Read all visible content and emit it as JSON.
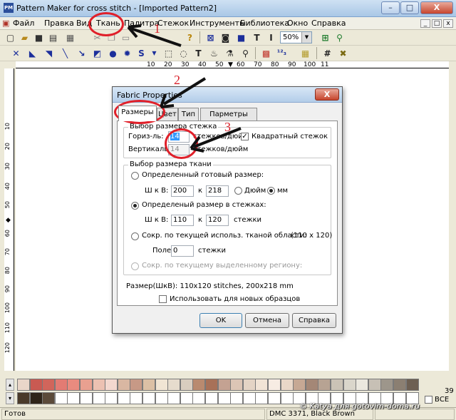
{
  "window": {
    "title": "Pattern Maker for cross stitch - [Imported Pattern2]",
    "app_icon_text": "PM",
    "minimize": "–",
    "maximize": "□",
    "close": "X"
  },
  "menubar": {
    "items": [
      "Файл",
      "Правка",
      "Вид",
      "Ткань",
      "Палитра",
      "Стежок",
      "Инструменты",
      "Библиотека",
      "Окно",
      "Справка"
    ],
    "mdi_buttons": [
      "_",
      "□",
      "x"
    ]
  },
  "toolbar1": {
    "zoom_value": "50%"
  },
  "ruler": {
    "top_labels": [
      "10",
      "20",
      "30",
      "40",
      "50",
      "60",
      "70",
      "80",
      "90",
      "100",
      "11"
    ],
    "left_labels": [
      "10",
      "20",
      "30",
      "40",
      "50",
      "60",
      "70",
      "80",
      "90",
      "100",
      "110",
      "120"
    ]
  },
  "dialog": {
    "title": "Fabric Properties",
    "close": "X",
    "tabs": [
      "Размеры",
      "Цвет",
      "Тип",
      "Парметры сетки"
    ],
    "stitch_group": {
      "label": "Выбор размера стежка",
      "horizontal_label": "Гориз-ль:",
      "horizontal_value": "14",
      "horizontal_unit": "стежков/дюйм",
      "vertical_label": "Вертикальн:",
      "vertical_value": "14",
      "vertical_unit": "стежков/дюйм",
      "square_label": "Квадратный стежок",
      "square_checked": "✓"
    },
    "fabric_group": {
      "label": "Выбор размера ткани",
      "opt1_label": "Определенный готовый размер:",
      "opt1_wxh_label": "Ш к В:",
      "opt1_w": "200",
      "opt1_k": "к",
      "opt1_h": "218",
      "opt1_inch": "Дюйм",
      "opt1_mm": "мм",
      "opt2_label": "Определеный размер в стежках:",
      "opt2_wxh_label": "Ш к В:",
      "opt2_w": "110",
      "opt2_k": "к",
      "opt2_h": "120",
      "opt2_unit": "стежки",
      "opt3_label": "Сокр. по текущей использ. тканой области:",
      "opt3_size": "(110 x 120)",
      "opt3_field_label": "Поле:",
      "opt3_field_value": "0",
      "opt3_unit": "стежки",
      "opt4_label": "Сокр. по текущему выделенному региону:"
    },
    "size_summary": "Размер(ШкВ):  110x120 stitches,  200x218 mm",
    "use_for_new_label": "Использовать для новых образцов",
    "buttons": {
      "ok": "OK",
      "cancel": "Отмена",
      "help": "Справка"
    }
  },
  "palette": {
    "row1_colors": [
      "#e9d6c9",
      "#c95a52",
      "#d1655b",
      "#e37b73",
      "#e98b7f",
      "#e9a090",
      "#ecc1b2",
      "#f3d8cf",
      "#d9b7a2",
      "#c79986",
      "#dcc0a5",
      "#f1e5d4",
      "#e6dccd",
      "#d9cdbf",
      "#b98a6f",
      "#a87158",
      "#c4a292",
      "#dcc5b5",
      "#e4d4c5",
      "#f1e4d6",
      "#f7ece3",
      "#e9d7c8",
      "#c6a894",
      "#a48776",
      "#b7a393",
      "#cbc3b6",
      "#dad6cb",
      "#ebe8df",
      "#c7c0b5",
      "#9d968b",
      "#8b7f72",
      "#6d5f52"
    ],
    "row2_colors": [
      "#4a3a2a",
      "#2f2419",
      "#5b4a3a",
      "#ffffff",
      "#ffffff",
      "#ffffff",
      "#ffffff",
      "#ffffff",
      "#ffffff",
      "#ffffff",
      "#ffffff",
      "#ffffff",
      "#ffffff",
      "#ffffff",
      "#ffffff",
      "#ffffff",
      "#ffffff",
      "#ffffff",
      "#ffffff",
      "#ffffff",
      "#ffffff",
      "#ffffff",
      "#ffffff",
      "#ffffff",
      "#ffffff",
      "#ffffff",
      "#ffffff",
      "#ffffff",
      "#ffffff",
      "#ffffff",
      "#ffffff",
      "#ffffff"
    ],
    "counter": "39",
    "all_label": "ВСЕ"
  },
  "statusbar": {
    "ready": "Готов",
    "color": "DMC  3371, Black Brown"
  },
  "annotations": {
    "n1": "1",
    "n2": "2",
    "n3": "3",
    "watermark": "© Katya для gotovim-doma.ru"
  }
}
